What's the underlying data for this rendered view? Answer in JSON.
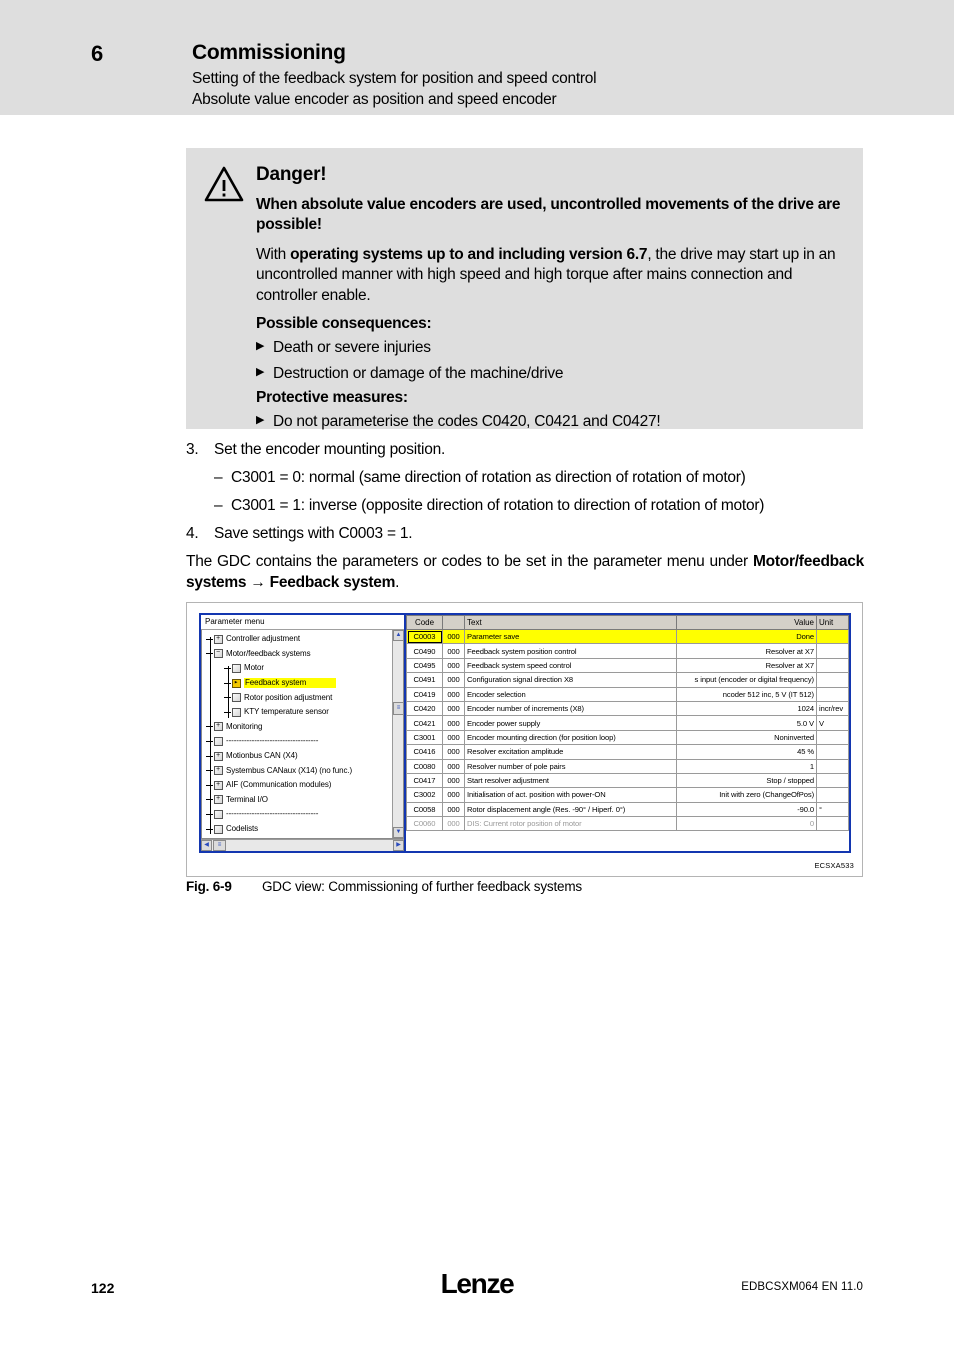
{
  "header": {
    "chapter_number": "6",
    "chapter_title": "Commissioning",
    "subtitle_1": "Setting of the feedback system for position and speed control",
    "subtitle_2": "Absolute value encoder as position and speed encoder",
    "band_color": "#dedede"
  },
  "danger": {
    "icon": "warning-triangle-icon",
    "title": "Danger!",
    "headline": "When absolute value encoders are used, uncontrolled movements of the drive are possible!",
    "paragraph_pre": "With ",
    "paragraph_bold": "operating systems up to and including version 6.7",
    "paragraph_post": ", the drive may start up in an uncontrolled manner with high speed and high torque after mains connection and controller enable.",
    "consequences_label": "Possible consequences:",
    "consequences": [
      "Death or severe injuries",
      "Destruction or damage of the machine/drive"
    ],
    "measures_label": "Protective measures:",
    "measures": [
      "Do not parameterise the codes C0420, C0421 and C0427!"
    ],
    "bullet_glyph": "▶",
    "box_color": "#dedede"
  },
  "steps": [
    {
      "num": "3.",
      "text": "Set the encoder mounting position."
    },
    {
      "dash": "–",
      "text": "C3001 = 0: normal (same direction of rotation as direction of rotation of motor)"
    },
    {
      "dash": "–",
      "text": "C3001 = 1: inverse (opposite direction of rotation to direction of rotation of motor)"
    },
    {
      "num": "4.",
      "text": "Save settings with C0003 = 1."
    }
  ],
  "gdc_paragraph": {
    "line1": "The GDC contains the parameters or codes to be set in the parameter menu under",
    "line2": "Motor/feedback systems → Feedback system",
    "line2_suffix": "."
  },
  "figure": {
    "id_code": "ECSXA533",
    "caption_id": "Fig. 6-9",
    "caption_text": "GDC view: Commissioning of further feedback systems",
    "window_border_color": "#1336b0",
    "highlight_color": "#ffff00"
  },
  "tree": {
    "header": "Parameter menu",
    "items": [
      {
        "label": "Controller adjustment",
        "level": 1,
        "icon": "folder-plus-icon",
        "expandable": true,
        "selected": false
      },
      {
        "label": "Motor/feedback systems",
        "level": 1,
        "icon": "folder-minus-icon",
        "expandable": true,
        "selected": false
      },
      {
        "label": "Motor",
        "level": 2,
        "icon": "folder-icon",
        "expandable": false,
        "selected": false
      },
      {
        "label": "Feedback system",
        "level": 2,
        "icon": "folder-selected-icon",
        "expandable": false,
        "selected": true
      },
      {
        "label": "Rotor position adjustment",
        "level": 2,
        "icon": "folder-icon",
        "expandable": false,
        "selected": false
      },
      {
        "label": "KTY temperature sensor",
        "level": 2,
        "icon": "folder-icon",
        "expandable": false,
        "selected": false
      },
      {
        "label": "Monitoring",
        "level": 1,
        "icon": "folder-plus-icon",
        "expandable": true,
        "selected": false
      },
      {
        "label": "------------------------------------",
        "level": 1,
        "icon": "folder-icon",
        "expandable": false,
        "selected": false
      },
      {
        "label": "Motionbus CAN (X4)",
        "level": 1,
        "icon": "folder-plus-icon",
        "expandable": true,
        "selected": false
      },
      {
        "label": "Systembus CANaux (X14)  (no func.)",
        "level": 1,
        "icon": "folder-plus-icon",
        "expandable": true,
        "selected": false
      },
      {
        "label": "AIF (Communication modules)",
        "level": 1,
        "icon": "folder-plus-icon",
        "expandable": true,
        "selected": false
      },
      {
        "label": "Terminal I/O",
        "level": 1,
        "icon": "folder-plus-icon",
        "expandable": true,
        "selected": false
      },
      {
        "label": "------------------------------------",
        "level": 1,
        "icon": "folder-icon",
        "expandable": false,
        "selected": false
      },
      {
        "label": "Codelists",
        "level": 1,
        "icon": "folder-icon",
        "expandable": false,
        "selected": false
      }
    ],
    "scroll_up": "▲",
    "scroll_down": "▼",
    "scroll_left": "◀",
    "scroll_right": "▶",
    "scroll_thumb": "≡"
  },
  "table": {
    "columns": [
      "Code",
      "",
      "Text",
      "Value",
      "Unit"
    ],
    "rows": [
      {
        "code": "C0003",
        "sub": "000",
        "text": "Parameter save",
        "value": "Done",
        "unit": "",
        "highlight": true,
        "dim": false
      },
      {
        "code": "C0490",
        "sub": "000",
        "text": "Feedback system position control",
        "value": "Resolver at X7",
        "unit": "",
        "highlight": false,
        "dim": false
      },
      {
        "code": "C0495",
        "sub": "000",
        "text": "Feedback system speed control",
        "value": "Resolver at X7",
        "unit": "",
        "highlight": false,
        "dim": false
      },
      {
        "code": "C0491",
        "sub": "000",
        "text": "Configuration signal direction X8",
        "value": "s input (encoder or digital frequency)",
        "unit": "",
        "highlight": false,
        "dim": false
      },
      {
        "code": "C0419",
        "sub": "000",
        "text": "Encoder selection",
        "value": "ncoder       512 inc, 5 V   (IT  512)",
        "unit": "",
        "highlight": false,
        "dim": false
      },
      {
        "code": "C0420",
        "sub": "000",
        "text": "Encoder number of increments (X8)",
        "value": "1024",
        "unit": "incr/rev",
        "highlight": false,
        "dim": false
      },
      {
        "code": "C0421",
        "sub": "000",
        "text": "Encoder power supply",
        "value": "5.0 V",
        "unit": "V",
        "highlight": false,
        "dim": false
      },
      {
        "code": "C3001",
        "sub": "000",
        "text": "Encoder mounting direction  (for position loop)",
        "value": "Noninverted",
        "unit": "",
        "highlight": false,
        "dim": false
      },
      {
        "code": "C0416",
        "sub": "000",
        "text": "Resolver excitation amplitude",
        "value": "45 %",
        "unit": "",
        "highlight": false,
        "dim": false
      },
      {
        "code": "C0080",
        "sub": "000",
        "text": "Resolver number of pole pairs",
        "value": "1",
        "unit": "",
        "highlight": false,
        "dim": false
      },
      {
        "code": "C0417",
        "sub": "000",
        "text": "Start resolver adjustment",
        "value": "Stop / stopped",
        "unit": "",
        "highlight": false,
        "dim": false
      },
      {
        "code": "C3002",
        "sub": "000",
        "text": "Initialisation of act. position with power-ON",
        "value": "Init with zero (ChangeOfPos)",
        "unit": "",
        "highlight": false,
        "dim": false
      },
      {
        "code": "C0058",
        "sub": "000",
        "text": "Rotor displacement angle (Res. -90° / Hiperf. 0°)",
        "value": "-90.0",
        "unit": "°",
        "highlight": false,
        "dim": false
      },
      {
        "code": "C0060",
        "sub": "000",
        "text": "DIS: Current rotor position of motor",
        "value": "0",
        "unit": "",
        "highlight": false,
        "dim": true
      }
    ]
  },
  "footer": {
    "page_number": "122",
    "logo": "Lenze",
    "document_id": "EDBCSXM064 EN 11.0"
  }
}
